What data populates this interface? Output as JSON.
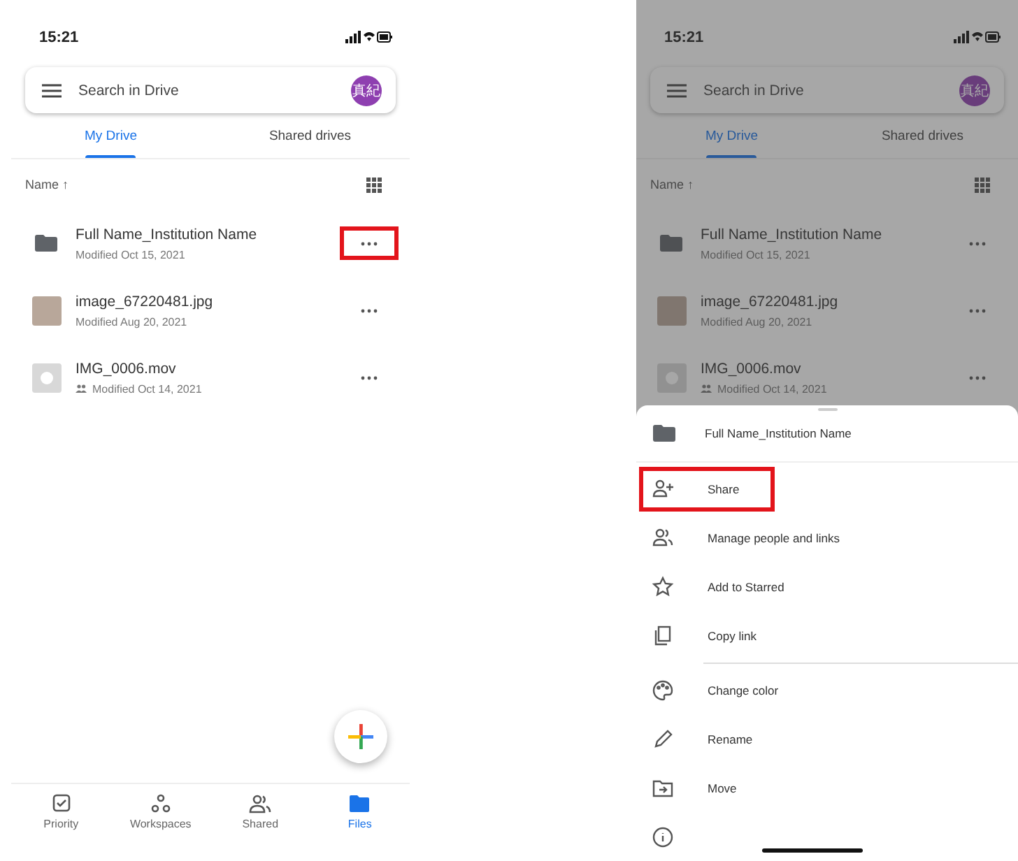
{
  "screens": [
    {
      "status_time": "15:21",
      "search": {
        "placeholder": "Search in Drive"
      },
      "avatar": "真紀",
      "dimmed": false,
      "tabs": [
        {
          "label": "My Drive",
          "selected": true
        },
        {
          "label": "Shared drives",
          "selected": false
        }
      ],
      "sort_label": "Name ↑",
      "files": [
        {
          "kind": "folder",
          "name": "Full Name_Institution Name",
          "modified": "Modified Oct 15, 2021",
          "shared": false,
          "highlighted": true
        },
        {
          "kind": "image",
          "name": "image_67220481.jpg",
          "modified": "Modified Aug 20, 2021",
          "shared": false,
          "highlighted": false
        },
        {
          "kind": "video",
          "name": "IMG_0006.mov",
          "modified": "Modified Oct 14, 2021",
          "shared": true,
          "highlighted": false
        }
      ],
      "bottom_nav": [
        {
          "kind": "priority",
          "label": "Priority",
          "selected": false
        },
        {
          "kind": "workspaces",
          "label": "Workspaces",
          "selected": false
        },
        {
          "kind": "shared",
          "label": "Shared",
          "selected": false
        },
        {
          "kind": "files",
          "label": "Files",
          "selected": true
        }
      ]
    },
    {
      "status_time": "15:21",
      "search": {
        "placeholder": "Search in Drive"
      },
      "avatar": "真紀",
      "dimmed": true,
      "tabs": [
        {
          "label": "My Drive",
          "selected": true
        },
        {
          "label": "Shared drives",
          "selected": false
        }
      ],
      "sort_label": "Name ↑",
      "files": [
        {
          "kind": "folder",
          "name": "Full Name_Institution Name",
          "modified": "Modified Oct 15, 2021",
          "shared": false,
          "highlighted": false
        },
        {
          "kind": "image",
          "name": "image_67220481.jpg",
          "modified": "Modified Aug 20, 2021",
          "shared": false,
          "highlighted": false
        },
        {
          "kind": "video",
          "name": "IMG_0006.mov",
          "modified": "Modified Oct 14, 2021",
          "shared": true,
          "highlighted": false
        }
      ],
      "menu": {
        "title": "Full Name_Institution Name",
        "items": [
          {
            "kind": "share",
            "label": "Share",
            "highlighted": true
          },
          {
            "kind": "manage",
            "label": "Manage people and links",
            "highlighted": false
          },
          {
            "kind": "star",
            "label": "Add to Starred",
            "highlighted": false
          },
          {
            "kind": "copy",
            "label": "Copy link",
            "highlighted": false
          },
          {
            "kind": "color",
            "label": "Change color",
            "highlighted": false
          },
          {
            "kind": "rename",
            "label": "Rename",
            "highlighted": false
          },
          {
            "kind": "move",
            "label": "Move",
            "highlighted": false
          },
          {
            "kind": "details",
            "highlighted": false
          }
        ]
      }
    }
  ]
}
